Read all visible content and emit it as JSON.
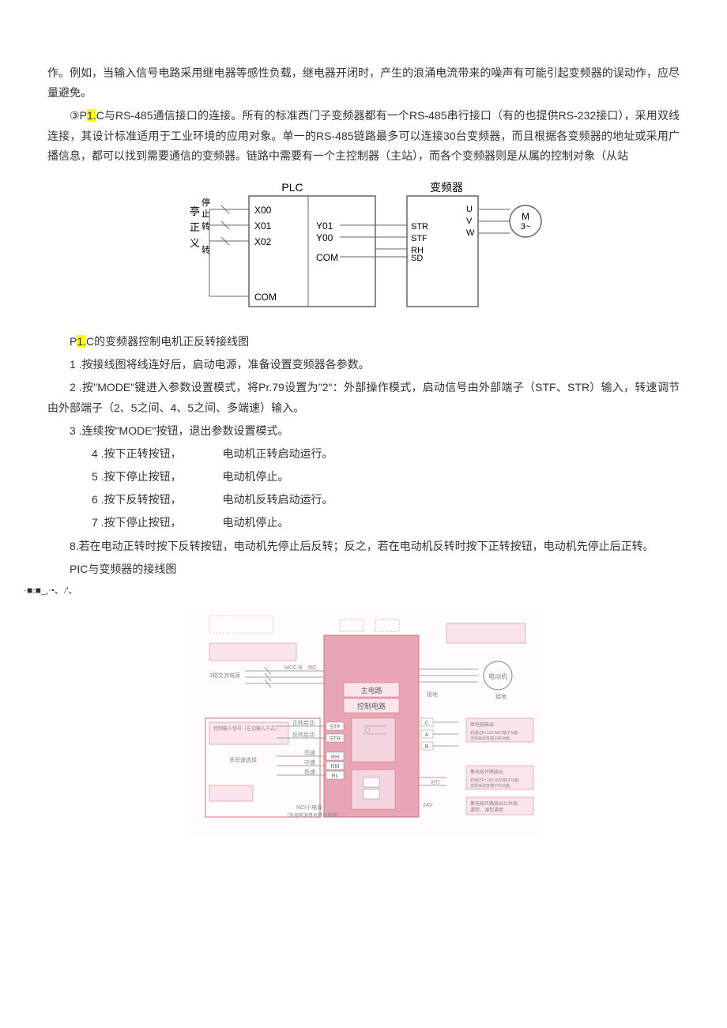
{
  "para1": "作。例如，当输入信号电路采用继电器等感性负载，继电器开闭时，产生的浪涌电流带来的噪声有可能引起变频器的误动作，应尽量避免。",
  "para2_prefix": "③P",
  "para2_highlight": "1.",
  "para2_rest": "C与RS-485通信接口的连接。所有的标准西门子变频器都有一个RS-485串行接口（有的也提供RS-232接口），采用双线连接，其设计标准适用于工业环境的应用对象。单一的RS-485链路最多可以连接30台变频器，而且根据各变频器的地址或采用广播信息，都可以找到需要通信的变频器。链路中需要有一个主控制器（主站），而各个变频器则是从属的控制对象（从站",
  "diagram1": {
    "plc_label": "PLC",
    "vfd_label": "变频器",
    "left_labels": [
      "停",
      "止",
      "转",
      "义",
      "转"
    ],
    "left_labels_alt": [
      "亭",
      "正",
      "义"
    ],
    "x_terminals": [
      "X00",
      "X01",
      "X02"
    ],
    "y_terminals": [
      "Y01",
      "Y00"
    ],
    "com_labels": [
      "COM",
      "COM"
    ],
    "vfd_inputs": [
      "STR",
      "STF",
      "RH",
      "SD"
    ],
    "vfd_outputs": [
      "U",
      "V",
      "W"
    ],
    "motor": [
      "M",
      "3~"
    ]
  },
  "caption1_prefix": "P",
  "caption1_highlight": "1.",
  "caption1_rest": "C的变频器控制电机正反转接线图",
  "step1": "1 .按接线图将线连好后，启动电源，准备设置变频器各参数。",
  "step2": "2 .按\"MODE\"键进入参数设置模式，将Pr.79设置为\"2\"：外部操作模式，启动信号由外部端子（STF、STR）输入，转速调节由外部端子（2、5之间、4、5之间、多端速）输入。",
  "step3": "3 .连续按\"MODE\"按钮，退出参数设置模式。",
  "step4_a": "4 .按下正转按钮，",
  "step4_b": "电动机正转启动运行。",
  "step5_a": "5 .按下停止按钮，",
  "step5_b": "电动机停止。",
  "step6_a": "6 .按下反转按钮，",
  "step6_b": "电动机反转启动运行。",
  "step7_a": "7 .按下停止按钮，",
  "step7_b": "电动机停止。",
  "step8": "8.若在电动正转时按下反转按钮，电动机先停止后反转；反之，若在电动机反转时按下正转按钮，电动机先停止后正转。",
  "caption2": "PIC与变频器的接线图",
  "symbols": "·■:■_,·•、/'、",
  "diagram2": {
    "main_circuit": "主电路",
    "control_circuit": "控制电路",
    "terminals": [
      "STF",
      "STR",
      "RH",
      "RM",
      "RL"
    ],
    "right_terminals": [
      "C",
      "A",
      "B"
    ],
    "bottom_label": "NCI小电源",
    "ground": "接地"
  }
}
